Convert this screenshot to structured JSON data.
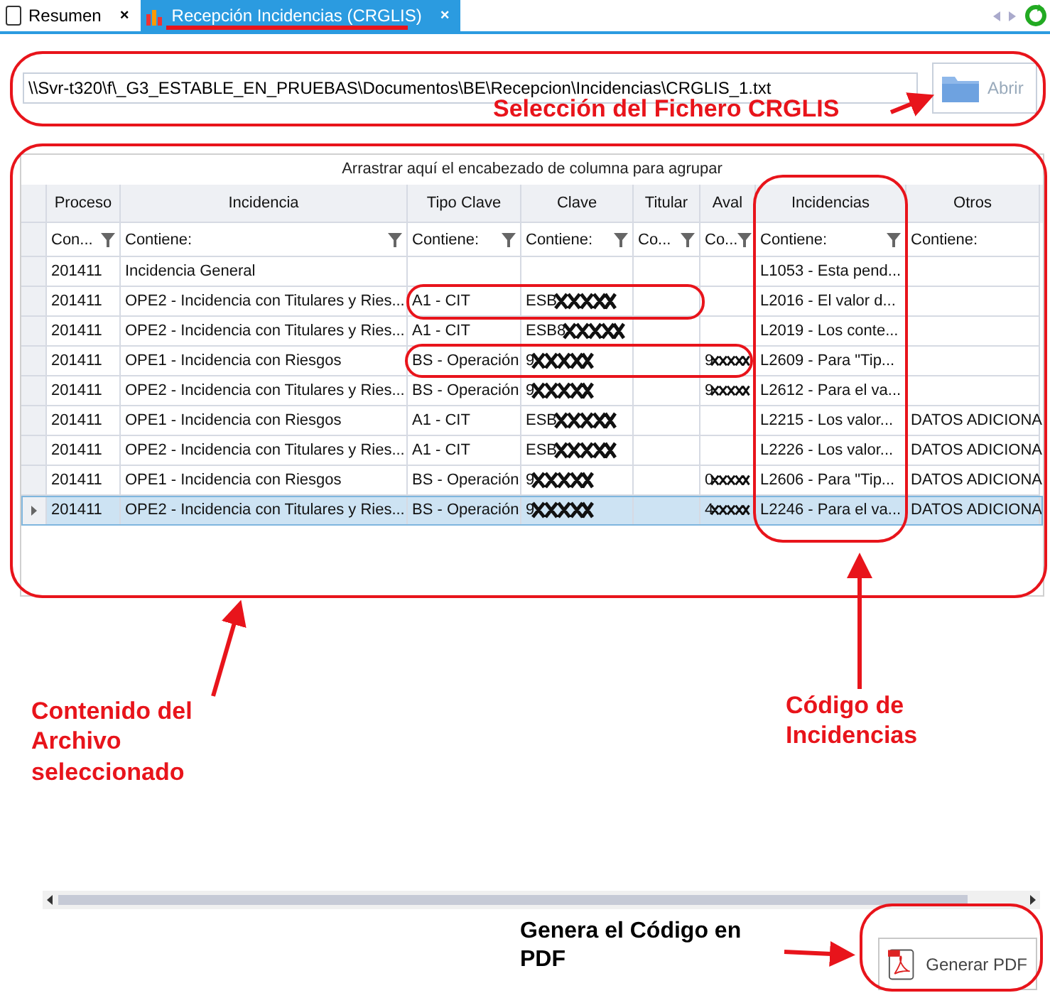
{
  "tabs": [
    {
      "label": "Resumen",
      "selected": false,
      "kind": "document",
      "close": "×"
    },
    {
      "label": "Recepción Incidencias (CRGLIS)",
      "selected": true,
      "kind": "chart",
      "close": "×"
    }
  ],
  "file": {
    "path": "\\\\Svr-t320\\f\\_G3_ESTABLE_EN_PRUEBAS\\Documentos\\BE\\Recepcion\\Incidencias\\CRGLIS_1.txt",
    "button": "Abrir",
    "button_disabled": true
  },
  "grid": {
    "group_hint": "Arrastrar aquí el encabezado de columna para agrupar",
    "columns": [
      {
        "label": "Proceso",
        "filter": "Con..."
      },
      {
        "label": "Incidencia",
        "filter": "Contiene:"
      },
      {
        "label": "Tipo Clave",
        "filter": "Contiene:"
      },
      {
        "label": "Clave",
        "filter": "Contiene:"
      },
      {
        "label": "Titular",
        "filter": "Co..."
      },
      {
        "label": "Aval",
        "filter": "Co..."
      },
      {
        "label": "Incidencias",
        "filter": "Contiene:"
      },
      {
        "label": "Otros",
        "filter": "Contiene:"
      }
    ],
    "rows": [
      {
        "selected": false,
        "cells": [
          {
            "text": "201411"
          },
          {
            "text": "Incidencia General"
          },
          {
            "text": ""
          },
          {
            "text": ""
          },
          {
            "text": ""
          },
          {
            "text": ""
          },
          {
            "text": "L1053 - Esta pend..."
          },
          {
            "text": ""
          }
        ]
      },
      {
        "selected": false,
        "cells": [
          {
            "text": "201411"
          },
          {
            "text": "OPE2 - Incidencia con Titulares y Ries..."
          },
          {
            "text": "A1 - CIT"
          },
          {
            "text": "ESB",
            "redacted": true
          },
          {
            "text": ""
          },
          {
            "text": ""
          },
          {
            "text": "L2016 - El valor d..."
          },
          {
            "text": ""
          }
        ]
      },
      {
        "selected": false,
        "cells": [
          {
            "text": "201411"
          },
          {
            "text": "OPE2 - Incidencia con Titulares y Ries..."
          },
          {
            "text": "A1 - CIT"
          },
          {
            "text": "ESB8",
            "redacted": true
          },
          {
            "text": ""
          },
          {
            "text": ""
          },
          {
            "text": "L2019 - Los conte..."
          },
          {
            "text": ""
          }
        ]
      },
      {
        "selected": false,
        "cells": [
          {
            "text": "201411"
          },
          {
            "text": "OPE1 - Incidencia con Riesgos"
          },
          {
            "text": "BS - Operación"
          },
          {
            "text": "9",
            "redacted": true
          },
          {
            "text": ""
          },
          {
            "text": "9",
            "redacted": true
          },
          {
            "text": "L2609 - Para \"Tip..."
          },
          {
            "text": ""
          }
        ]
      },
      {
        "selected": false,
        "cells": [
          {
            "text": "201411"
          },
          {
            "text": "OPE2 - Incidencia con Titulares y Ries..."
          },
          {
            "text": "BS - Operación"
          },
          {
            "text": "9",
            "redacted": true
          },
          {
            "text": ""
          },
          {
            "text": "9",
            "redacted": true
          },
          {
            "text": "L2612 - Para el va..."
          },
          {
            "text": ""
          }
        ]
      },
      {
        "selected": false,
        "cells": [
          {
            "text": "201411"
          },
          {
            "text": "OPE1 - Incidencia con Riesgos"
          },
          {
            "text": "A1 - CIT"
          },
          {
            "text": "ESB",
            "redacted": true
          },
          {
            "text": ""
          },
          {
            "text": ""
          },
          {
            "text": "L2215 - Los valor..."
          },
          {
            "text": "DATOS ADICIONA"
          }
        ]
      },
      {
        "selected": false,
        "cells": [
          {
            "text": "201411"
          },
          {
            "text": "OPE2 - Incidencia con Titulares y Ries..."
          },
          {
            "text": "A1 - CIT"
          },
          {
            "text": "ESB",
            "redacted": true
          },
          {
            "text": ""
          },
          {
            "text": ""
          },
          {
            "text": "L2226 - Los valor..."
          },
          {
            "text": "DATOS ADICIONA"
          }
        ]
      },
      {
        "selected": false,
        "cells": [
          {
            "text": "201411"
          },
          {
            "text": "OPE1 - Incidencia con Riesgos"
          },
          {
            "text": "BS - Operación"
          },
          {
            "text": "9",
            "redacted": true
          },
          {
            "text": ""
          },
          {
            "text": "0",
            "redacted": true
          },
          {
            "text": "L2606 - Para \"Tip..."
          },
          {
            "text": "DATOS ADICIONA"
          }
        ]
      },
      {
        "selected": true,
        "cells": [
          {
            "text": "201411"
          },
          {
            "text": "OPE2 - Incidencia con Titulares y Ries..."
          },
          {
            "text": "BS - Operación"
          },
          {
            "text": "9",
            "redacted": true
          },
          {
            "text": ""
          },
          {
            "text": "4",
            "redacted": true
          },
          {
            "text": "L2246 - Para el va..."
          },
          {
            "text": "DATOS ADICIONA"
          }
        ]
      }
    ]
  },
  "pdf_button": "Generar PDF",
  "callouts": [
    {
      "text": "Selección del Fichero CRGLIS",
      "kind": "red"
    },
    {
      "text": "Contenido del Archivo seleccionado",
      "kind": "red"
    },
    {
      "text": "Código de Incidencias",
      "kind": "red"
    },
    {
      "text": "Genera el Código en PDF",
      "kind": "black"
    }
  ]
}
